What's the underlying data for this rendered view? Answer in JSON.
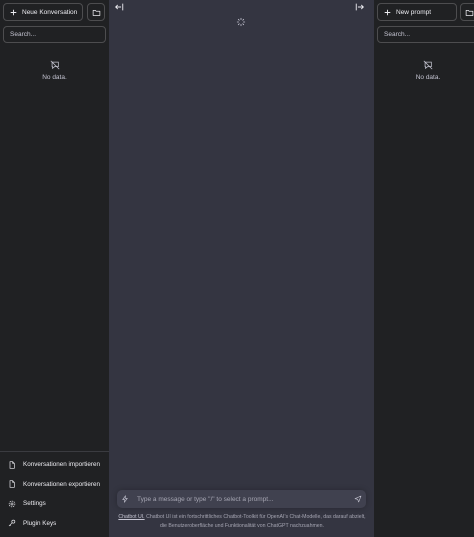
{
  "left_sidebar": {
    "new_button_label": "Neue Konversation",
    "search_placeholder": "Search...",
    "empty_text": "No data.",
    "bottom_items": [
      {
        "label": "Konversationen importieren",
        "icon": "file-import-icon"
      },
      {
        "label": "Konversationen exportieren",
        "icon": "file-export-icon"
      },
      {
        "label": "Settings",
        "icon": "settings-icon"
      },
      {
        "label": "Plugin Keys",
        "icon": "key-icon"
      }
    ]
  },
  "right_sidebar": {
    "new_button_label": "New prompt",
    "search_placeholder": "Search...",
    "empty_text": "No data."
  },
  "main": {
    "input_placeholder": "Type a message or type \"/\" to select a prompt...",
    "footer_link": "Chatbot UI.",
    "footer_text": " Chatbot UI ist ein fortschrittliches Chatbot-Toolkit für OpenAI's Chat-Modelle, das darauf abzielt, die Benutzeroberfläche und Funktionalität von ChatGPT nachzuahmen."
  },
  "colors": {
    "sidebar_bg": "#202123",
    "main_bg": "#343541",
    "input_bg": "#40414f",
    "border": "#4d4d4f",
    "text": "#ececf1"
  }
}
